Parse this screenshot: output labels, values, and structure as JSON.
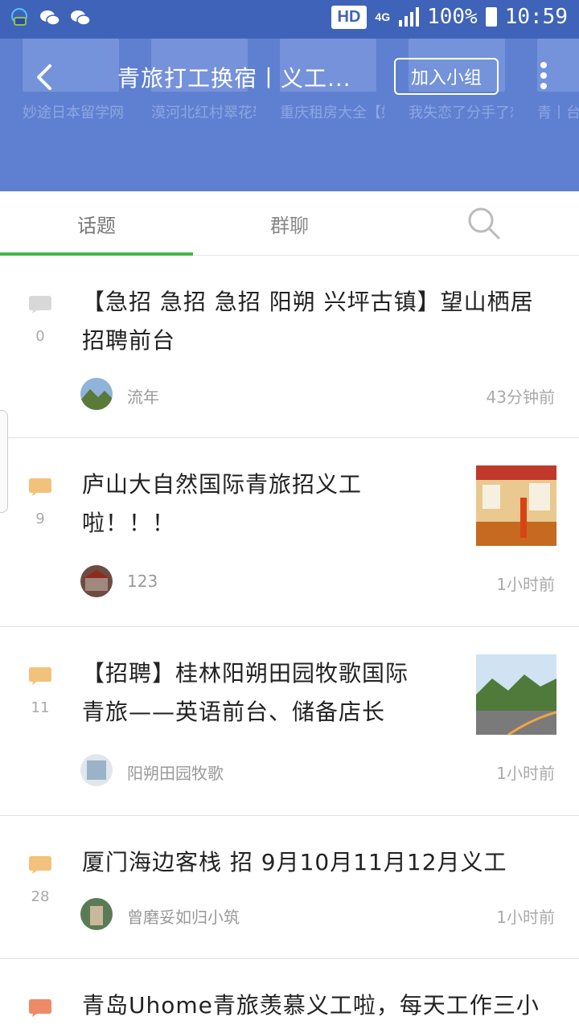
{
  "status_bar": {
    "hd": "HD",
    "network": "4G",
    "battery": "100%",
    "time": "10:59"
  },
  "header": {
    "title": "青旅打工换宿丨义工...",
    "join_label": "加入小组",
    "bg_groups": [
      {
        "name": "妙途日本留学网（免费..."
      },
      {
        "name": "漠河北红村翠花轩国际..."
      },
      {
        "name": "重庆租房大全【好评..."
      },
      {
        "name": "我失恋了分手了想挽回..."
      },
      {
        "name": "青丨台丨藏"
      }
    ]
  },
  "tabs": [
    {
      "label": "话题"
    },
    {
      "label": "群聊"
    }
  ],
  "posts": [
    {
      "title_line1": "【急招 急招 急招 阳朔 兴坪古镇】望山栖居",
      "title_line2": "招聘前台",
      "count": "0",
      "author": "流年",
      "time": "43分钟前",
      "bubble_color": "#d8d8d8"
    },
    {
      "title_line1": "庐山大自然国际青旅招义工",
      "title_line2": "啦！！！",
      "count": "9",
      "author": "123",
      "time": "1小时前",
      "bubble_color": "#f2c27a"
    },
    {
      "title_line1": "【招聘】桂林阳朔田园牧歌国际",
      "title_line2": "青旅——英语前台、储备店长",
      "count": "11",
      "author": "阳朔田园牧歌",
      "time": "1小时前",
      "bubble_color": "#f2c27a"
    },
    {
      "title_line1": "厦门海边客栈 招 9月10月11月12月义工",
      "count": "28",
      "author": "曾磨妥如归小筑",
      "time": "1小时前",
      "bubble_color": "#f2c27a"
    },
    {
      "title_line1": "青岛Uhome青旅羡慕义工啦，每天工作三小",
      "bubble_color": "#ee8a66"
    }
  ]
}
